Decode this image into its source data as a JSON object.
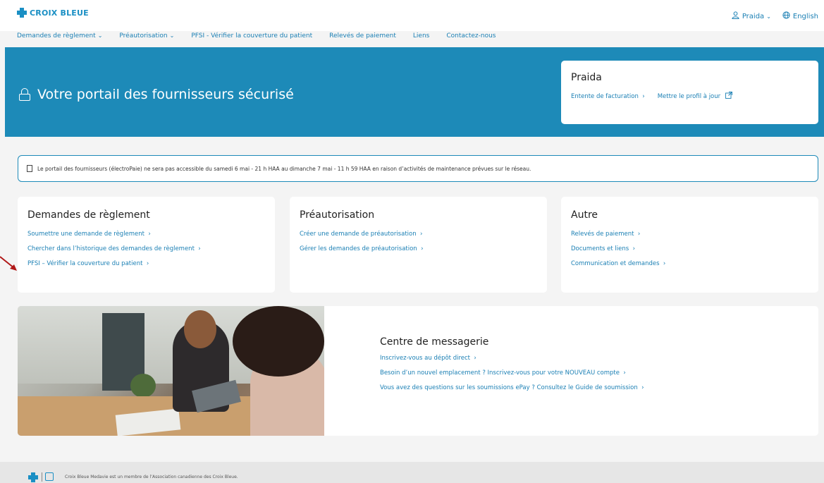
{
  "header": {
    "logo_text": "CROIX BLEUE",
    "user_label": "Praida",
    "language_label": "English",
    "brand_color": "#1a8fc4"
  },
  "nav": {
    "items": [
      {
        "label": "Demandes de règlement",
        "has_dropdown": true
      },
      {
        "label": "Préautorisation",
        "has_dropdown": true
      },
      {
        "label": "PFSI - Vérifier la couverture du patient",
        "has_dropdown": false
      },
      {
        "label": "Relevés de paiement",
        "has_dropdown": false
      },
      {
        "label": "Liens",
        "has_dropdown": false
      },
      {
        "label": "Contactez-nous",
        "has_dropdown": false
      }
    ]
  },
  "hero": {
    "title": "Votre portail des fournisseurs sécurisé",
    "background_color": "#1d8ab8",
    "profile": {
      "name": "Praida",
      "billing_link": "Entente de facturation",
      "update_link": "Mettre le profil à jour"
    }
  },
  "notice": {
    "text": "Le portail des fournisseurs (électroPaie) ne sera pas accessible du samedi 6 mai - 21 h HAA au dimanche 7 mai - 11 h 59 HAA en raison d’activités de maintenance prévues sur le réseau."
  },
  "cards": [
    {
      "title": "Demandes de règlement",
      "links": [
        "Soumettre une demande de règlement",
        "Chercher dans l’historique des demandes de règlement",
        "PFSI – Vérifier la couverture du patient"
      ]
    },
    {
      "title": "Préautorisation",
      "links": [
        "Créer une demande de préautorisation",
        "Gérer les demandes de préautorisation"
      ]
    },
    {
      "title": "Autre",
      "links": [
        "Relevés de paiement",
        "Documents et liens",
        "Communication et demandes"
      ]
    }
  ],
  "message_center": {
    "title": "Centre de messagerie",
    "links": [
      "Inscrivez-vous au dépôt direct",
      "Besoin d’un nouvel emplacement ? Inscrivez-vous pour votre NOUVEAU compte",
      "Vous avez des questions sur les soumissions ePay ?  Consultez le Guide de soumission"
    ]
  },
  "footer": {
    "text": "Croix Bleue Medavie est un membre de l’Association canadienne des Croix Bleue."
  },
  "icons": {
    "user": "user-icon",
    "globe": "globe-icon",
    "lock": "lock-icon",
    "bookmark": "bookmark-icon",
    "external": "external-link-icon",
    "arrow_annotation": "red-arrow-annotation"
  }
}
